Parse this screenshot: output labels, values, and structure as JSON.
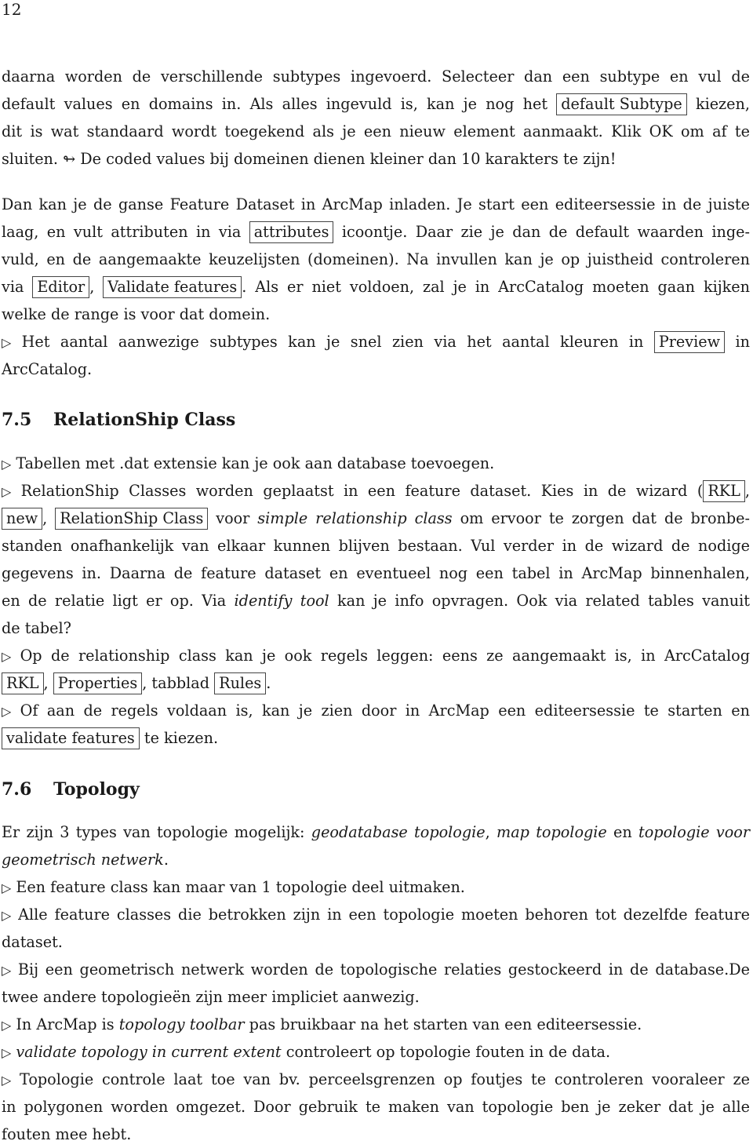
{
  "page_number": "12",
  "para1": {
    "l1": "daarna worden de verschillende subtypes ingevoerd.  Selecteer dan een subtype en vul de",
    "l2a": "default values en domains in.  Als alles ingevuld is, kan je nog het",
    "l2box": "default Subtype",
    "l2b": "kiezen,",
    "l3": "dit is wat standaard wordt toegekend als je een nieuw element aanmaakt. Klik OK om af te",
    "l4a": "sluiten.",
    "l4icon": "↬",
    "l4b": "De coded values bij domeinen dienen kleiner dan 10 karakters te zijn!"
  },
  "para2": {
    "l1": "Dan kan je de ganse Feature Dataset in ArcMap inladen.  Je start een editeersessie in de juiste",
    "l2a": "laag, en vult attributen in via",
    "l2box": "attributes",
    "l2b": "icoontje.  Daar zie je dan de default waarden inge-",
    "l3": "vuld, en de aangemaakte keuzelijsten (domeinen).  Na invullen kan je op juistheid controleren",
    "l4a": "via",
    "l4box1": "Editor",
    "l4box2": "Validate features",
    "l4b": ".  Als er niet voldoen, zal je in ArcCatalog moeten gaan kijken",
    "l5": "welke de range is voor dat domein."
  },
  "bullet_subtypes": {
    "a": "Het aantal aanwezige subtypes kan je snel zien via het aantal kleuren in",
    "box": "Preview",
    "b": "in",
    "c": "ArcCatalog."
  },
  "section75": {
    "number": "7.5",
    "title": "RelationShip Class",
    "b1": "Tabellen met .dat extensie kan je ook aan database toevoegen.",
    "b2": {
      "l1a": "RelationShip Classes worden geplaatst in een feature dataset.  Kies in de wizard (",
      "l1box": "RKL",
      "l1b": ",",
      "l2box1": "new",
      "l2box2": "RelationShip Class",
      "l2a": "voor",
      "l2i": "simple relationship class",
      "l2b": "om ervoor te zorgen dat de bronbe-",
      "l3": "standen onafhankelijk van elkaar kunnen blijven bestaan.  Vul verder in de wizard de nodige",
      "l4": "gegevens in.  Daarna de feature dataset en eventueel nog een tabel in ArcMap binnenhalen,",
      "l5a": "en de relatie ligt er op.  Via",
      "l5i": "identify tool",
      "l5b": "kan je info opvragen.  Ook via related tables vanuit",
      "l6": "de tabel?"
    },
    "b3": {
      "l1": "Op de relationship class kan je ook regels leggen:  eens ze aangemaakt is, in ArcCatalog",
      "box1": "RKL",
      "box2": "Properties",
      "mid": ", tabblad",
      "box3": "Rules",
      "end": "."
    },
    "b4": {
      "l1": "Of aan de regels voldaan is, kan je zien door in ArcMap een editeersessie te starten en",
      "box": "validate features",
      "end": "te kiezen."
    }
  },
  "section76": {
    "number": "7.6",
    "title": "Topology",
    "intro": {
      "a": "Er zijn 3 types van topologie mogelijk:",
      "i1": "geodatabase topologie",
      "sep": ",",
      "i2": "map topologie",
      "en": "en",
      "i3": "topologie voor",
      "i4": "geometrisch netwerk",
      "dot": "."
    },
    "b1": "Een feature class kan maar van 1 topologie deel uitmaken.",
    "b2a": "Alle feature classes die betrokken zijn in een topologie moeten behoren tot dezelfde feature",
    "b2b": "dataset.",
    "b3a": "Bij een geometrisch netwerk worden de topologische relaties gestockeerd in de database.De",
    "b3b": "twee andere topologieën zijn meer impliciet aanwezig.",
    "b4": {
      "a": "In ArcMap is",
      "i": "topology toolbar",
      "b": "pas bruikbaar na het starten van een editeersessie."
    },
    "b5": {
      "i": "validate topology in current extent",
      "b": "controleert op topologie fouten in de data."
    },
    "b6a": "Topologie controle laat toe van bv.  perceelsgrenzen op foutjes te controleren vooraleer ze",
    "b6b": "in polygonen worden omgezet.  Door gebruik te maken van topologie ben je zeker dat je alle",
    "b6c": "fouten mee hebt."
  },
  "bullet_glyph": "▷"
}
